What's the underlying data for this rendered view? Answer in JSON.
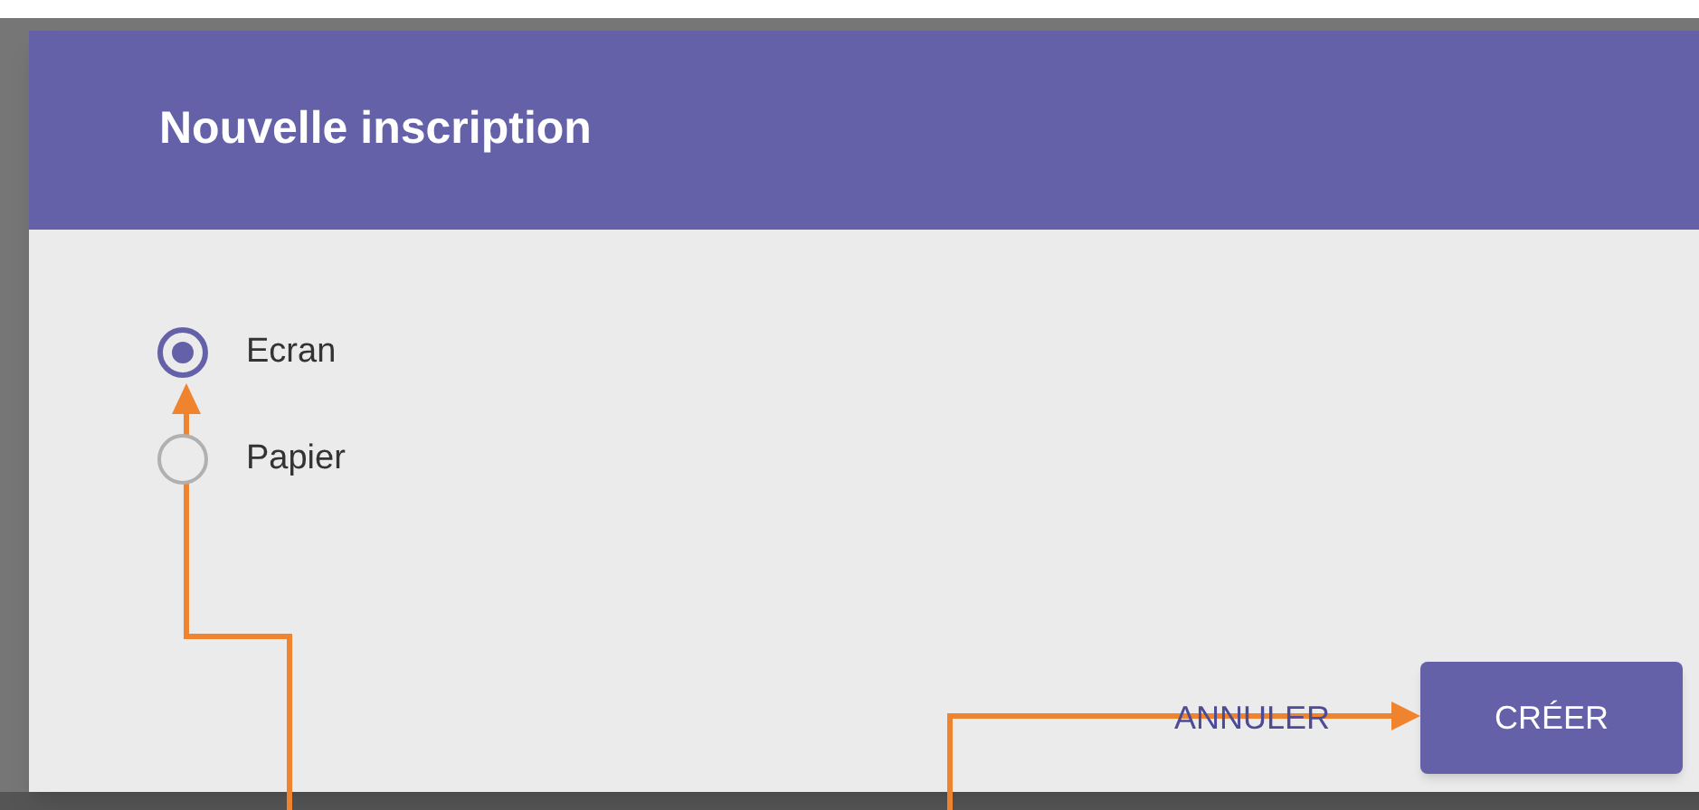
{
  "dialog": {
    "title": "Nouvelle inscription",
    "options": [
      {
        "label": "Ecran",
        "selected": true
      },
      {
        "label": "Papier",
        "selected": false
      }
    ],
    "buttons": [
      {
        "label": "ANNULER",
        "kind": "text"
      },
      {
        "label": "CRÉER",
        "kind": "filled"
      }
    ]
  }
}
